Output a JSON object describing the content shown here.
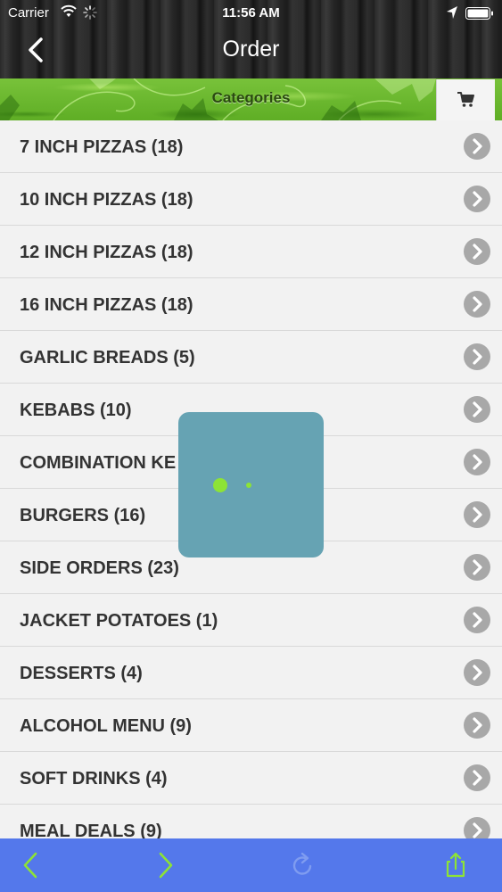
{
  "status_bar": {
    "carrier": "Carrier",
    "time": "11:56 AM",
    "icons": [
      "wifi-icon",
      "activity-spinner-icon",
      "location-arrow-icon",
      "battery-icon"
    ]
  },
  "nav": {
    "title": "Order",
    "back_icon": "chevron-left-icon"
  },
  "banner": {
    "label": "Categories",
    "cart_icon": "shopping-cart-icon"
  },
  "categories": [
    {
      "label": "7 INCH PIZZAS (18)"
    },
    {
      "label": "10 INCH PIZZAS (18)"
    },
    {
      "label": "12 INCH PIZZAS (18)"
    },
    {
      "label": "16 INCH PIZZAS (18)"
    },
    {
      "label": "GARLIC BREADS (5)"
    },
    {
      "label": "KEBABS (10)"
    },
    {
      "label": "COMBINATION KE"
    },
    {
      "label": "BURGERS (16)"
    },
    {
      "label": "SIDE ORDERS (23)"
    },
    {
      "label": "JACKET POTATOES (1)"
    },
    {
      "label": "DESSERTS (4)"
    },
    {
      "label": "ALCOHOL MENU (9)"
    },
    {
      "label": "SOFT DRINKS (4)"
    },
    {
      "label": "MEAL DEALS (9)"
    }
  ],
  "toolbar": {
    "back_icon": "arrow-left-icon",
    "forward_icon": "arrow-right-icon",
    "refresh_icon": "refresh-icon",
    "share_icon": "share-icon"
  },
  "colors": {
    "toolbar_bg": "#5478eb",
    "toolbar_icon": "#8de336",
    "banner_green": "#6cba30",
    "loading_bg": "#66a3b3",
    "chevron_bg": "#a8a8a8"
  }
}
